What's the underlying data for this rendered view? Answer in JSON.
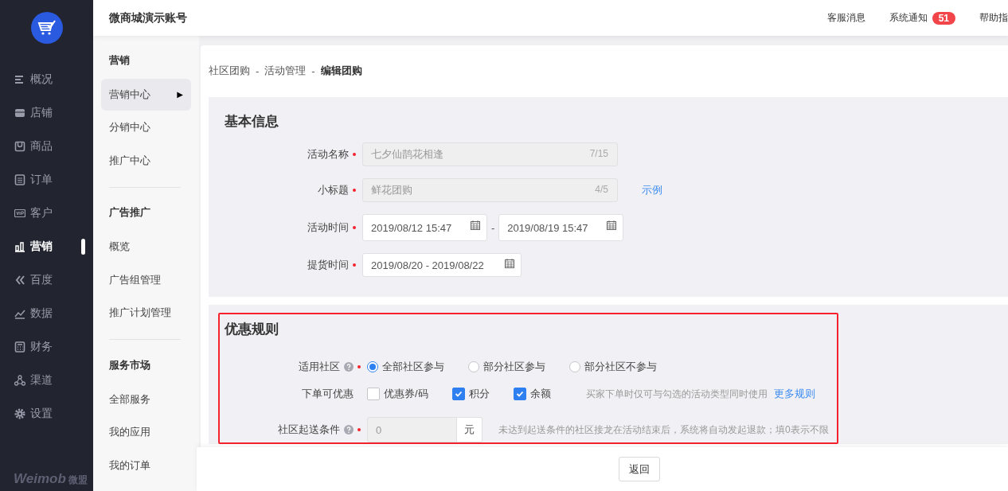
{
  "nav": {
    "items": [
      {
        "label": "概况",
        "selected": false
      },
      {
        "label": "店铺",
        "selected": false
      },
      {
        "label": "商品",
        "selected": false
      },
      {
        "label": "订单",
        "selected": false
      },
      {
        "label": "客户",
        "selected": false
      },
      {
        "label": "营销",
        "selected": true
      },
      {
        "label": "百度",
        "selected": false
      },
      {
        "label": "数据",
        "selected": false
      },
      {
        "label": "财务",
        "selected": false
      },
      {
        "label": "渠道",
        "selected": false
      },
      {
        "label": "设置",
        "selected": false
      }
    ],
    "brand": {
      "latin": "Weimob",
      "chinese": "微盟"
    }
  },
  "header": {
    "account": "微商城演示账号",
    "links": [
      {
        "label": "客服消息"
      },
      {
        "label": "系统通知",
        "badge": "51"
      },
      {
        "label": "帮助指"
      }
    ]
  },
  "subnav": {
    "groups": [
      {
        "title": "营销",
        "items": [
          {
            "label": "营销中心",
            "selected": true,
            "arrow": "▶"
          },
          {
            "label": "分销中心",
            "selected": false
          },
          {
            "label": "推广中心",
            "selected": false
          }
        ]
      },
      {
        "title": "广告推广",
        "items": [
          {
            "label": "概览",
            "selected": false
          },
          {
            "label": "广告组管理",
            "selected": false
          },
          {
            "label": "推广计划管理",
            "selected": false
          }
        ]
      },
      {
        "title": "服务市场",
        "items": [
          {
            "label": "全部服务",
            "selected": false
          },
          {
            "label": "我的应用",
            "selected": false
          },
          {
            "label": "我的订单",
            "selected": false
          }
        ]
      }
    ]
  },
  "breadcrumb": [
    {
      "kind": "link",
      "label": "社区团购"
    },
    {
      "kind": "separator",
      "label": "-"
    },
    {
      "kind": "link",
      "label": "活动管理"
    },
    {
      "kind": "separator",
      "label": "-"
    },
    {
      "kind": "current",
      "label": "编辑团购"
    }
  ],
  "basic_info": {
    "title": "基本信息",
    "highlighted": false,
    "fields": [
      {
        "kind": "text",
        "label": "活动名称",
        "required": true,
        "value": "七夕仙鹊花相逢",
        "counter": "7/15",
        "disabled": true
      },
      {
        "kind": "text",
        "label": "小标题",
        "required": true,
        "value": "鲜花团购",
        "counter": "4/5",
        "disabled": true,
        "link": "示例"
      },
      {
        "kind": "date_range",
        "label": "活动时间",
        "required": true,
        "start": "2019/08/12 15:47",
        "separator": "-",
        "end": "2019/08/19 15:47"
      },
      {
        "kind": "date",
        "label": "提货时间",
        "required": true,
        "value": "2019/08/20 - 2019/08/22"
      }
    ]
  },
  "rules": {
    "title": "优惠规则",
    "highlighted": true,
    "fields": [
      {
        "kind": "radio",
        "label": "适用社区",
        "help": true,
        "required": true,
        "options": [
          {
            "label": "全部社区参与",
            "selected": true
          },
          {
            "label": "部分社区参与",
            "selected": false
          },
          {
            "label": "部分社区不参与",
            "selected": false
          }
        ]
      },
      {
        "kind": "checkbox",
        "label": "下单可优惠",
        "required": false,
        "options": [
          {
            "label": "优惠券/码",
            "checked": false
          },
          {
            "label": "积分",
            "checked": true
          },
          {
            "label": "余额",
            "checked": true
          }
        ],
        "hint": "买家下单时仅可与勾选的活动类型同时使用",
        "link": "更多规则"
      },
      {
        "kind": "number",
        "label": "社区起送条件",
        "help": true,
        "required": true,
        "value": "0",
        "unit": "元",
        "disabled": true,
        "hint": "未达到起送条件的社区接龙在活动结束后，系统将自动发起退款；填0表示不限"
      }
    ]
  },
  "footer": {
    "buttons": [
      {
        "label": "返回"
      }
    ]
  }
}
